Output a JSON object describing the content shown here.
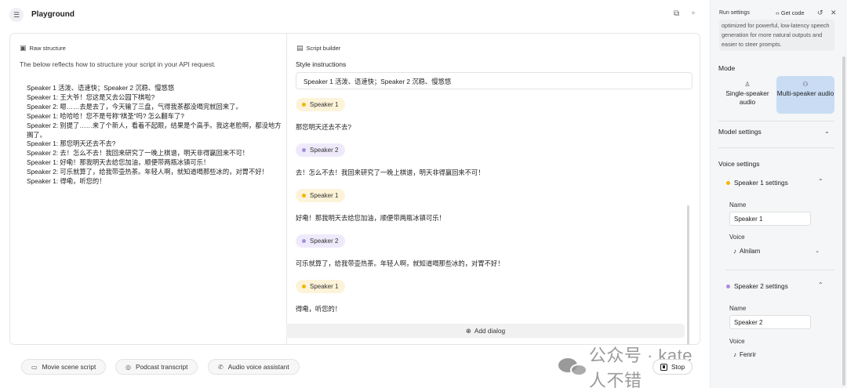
{
  "header": {
    "menu_icon": "collapse-menu-icon",
    "title": "Playground",
    "copy_icon": "copy-icon",
    "add_icon": "plus-icon"
  },
  "raw_structure": {
    "title": "Raw structure",
    "description": "The below reflects how to structure your script in your API request.",
    "lines": [
      "Speaker 1 活泼、语速快；Speaker 2 沉稳、慢悠悠",
      "Speaker 1: 王大爷！您这是又去公园下棋啦?",
      "Speaker 2: 嗯……去是去了，今天输了三盘，气得我茶都没喝完就回来了。",
      "Speaker 1: 哈哈哈！您不是号称\"棋圣\"吗? 怎么翻车了?",
      "Speaker 2: 别提了……来了个新人，看着不起眼，结果是个高手。我这老脸啊，都没地方搁了。",
      "Speaker 1: 那您明天还去不去?",
      "Speaker 2: 去！怎么不去！我回来研究了一晚上棋谱，明天非得赢回来不可！",
      "Speaker 1: 好嘞！那我明天去给您加油，顺便带两瓶冰镇可乐！",
      "Speaker 2: 可乐就算了，给我带壶热茶。年轻人啊，就知道喝那些冰的，对胃不好！",
      "Speaker 1: 得嘞，听您的！"
    ]
  },
  "script_builder": {
    "title": "Script builder",
    "style_label": "Style instructions",
    "style_value": "Speaker 1 活泼、语速快；Speaker 2 沉稳、慢悠悠",
    "dialogs": [
      {
        "speaker": "Speaker 1",
        "text": "那您明天还去不去?"
      },
      {
        "speaker": "Speaker 2",
        "text": "去！怎么不去！我回来研究了一晚上棋谱，明天非得赢回来不可！"
      },
      {
        "speaker": "Speaker 1",
        "text": "好嘞！那我明天去给您加油，顺便带两瓶冰镇可乐！"
      },
      {
        "speaker": "Speaker 2",
        "text": "可乐就算了，给我带壶热茶。年轻人啊，就知道喝那些冰的，对胃不好！"
      },
      {
        "speaker": "Speaker 1",
        "text": "得嘞，听您的！"
      }
    ],
    "add_dialog_label": "Add dialog"
  },
  "bottom": {
    "buttons": [
      "Movie scene script",
      "Podcast transcript",
      "Audio voice assistant"
    ],
    "stop_label": "Stop"
  },
  "watermark": "公众号 · kate人不错",
  "run_settings": {
    "title": "Run settings",
    "get_code": "Get code",
    "model_description": "optimized for powerful, low-latency speech generation for more natural outputs and easier to steer prompts.",
    "mode_label": "Mode",
    "mode_single": "Single-speaker audio",
    "mode_multi": "Multi-speaker audio",
    "model_settings_label": "Model settings",
    "voice_settings_label": "Voice settings",
    "speaker1": {
      "header": "Speaker 1 settings",
      "name_label": "Name",
      "name_value": "Speaker 1",
      "voice_label": "Voice",
      "voice_value": "Alnilam"
    },
    "speaker2": {
      "header": "Speaker 2 settings",
      "name_label": "Name",
      "name_value": "Speaker 2",
      "voice_label": "Voice",
      "voice_value": "Fenrir"
    }
  },
  "colors": {
    "speaker1_dot": "#f2b705",
    "speaker2_dot": "#a98be0",
    "speaker1_chip": "#fdf3d8",
    "speaker2_chip": "#efeafb",
    "mode_active": "#c9dcf3"
  }
}
